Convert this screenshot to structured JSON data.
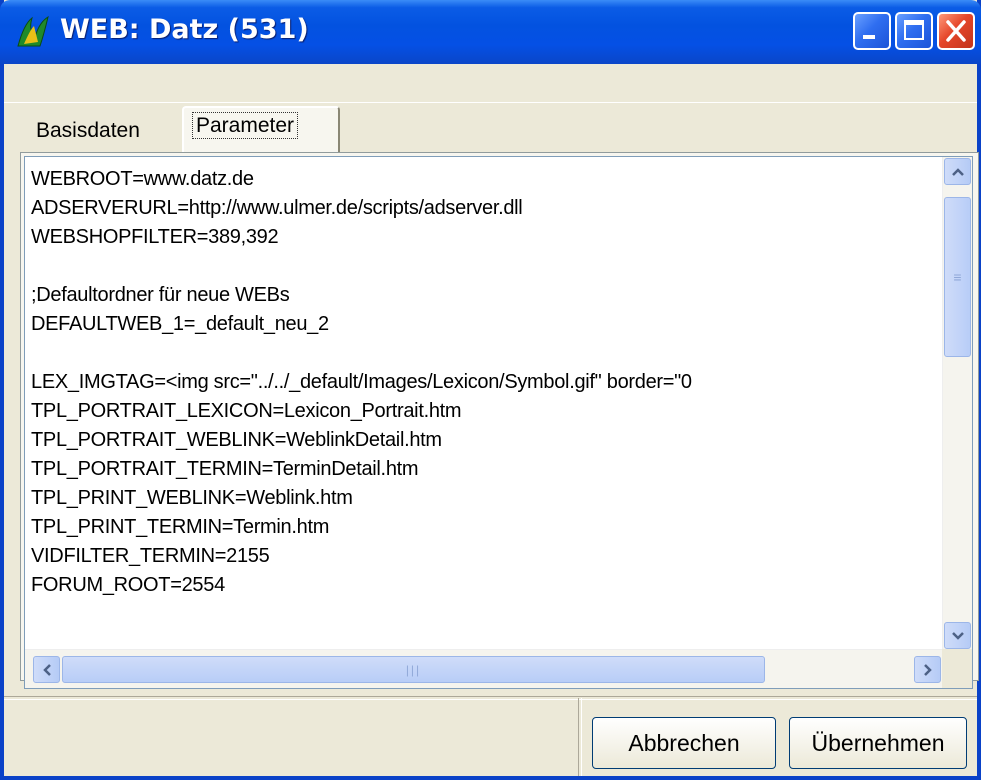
{
  "window": {
    "title": "WEB: Datz (531)",
    "icon": "app-icon"
  },
  "tabs": [
    {
      "label": "Basisdaten",
      "selected": false
    },
    {
      "label": "Parameter",
      "selected": true
    }
  ],
  "editor": {
    "lines": [
      "WEBROOT=www.datz.de",
      "ADSERVERURL=http://www.ulmer.de/scripts/adserver.dll",
      "WEBSHOPFILTER=389,392",
      "",
      ";Defaultordner für neue WEBs",
      "DEFAULTWEB_1=_default_neu_2",
      "",
      "LEX_IMGTAG=<img src=\"../../_default/Images/Lexicon/Symbol.gif\" border=\"0",
      "TPL_PORTRAIT_LEXICON=Lexicon_Portrait.htm",
      "TPL_PORTRAIT_WEBLINK=WeblinkDetail.htm",
      "TPL_PORTRAIT_TERMIN=TerminDetail.htm",
      "TPL_PRINT_WEBLINK=Weblink.htm",
      "TPL_PRINT_TERMIN=Termin.htm",
      "VIDFILTER_TERMIN=2155",
      "FORUM_ROOT=2554"
    ]
  },
  "buttons": {
    "cancel": "Abbrechen",
    "apply": "Übernehmen"
  },
  "colors": {
    "titlebar": "#0352e0",
    "close": "#e5462a",
    "dialog_bg": "#ece9d8"
  }
}
